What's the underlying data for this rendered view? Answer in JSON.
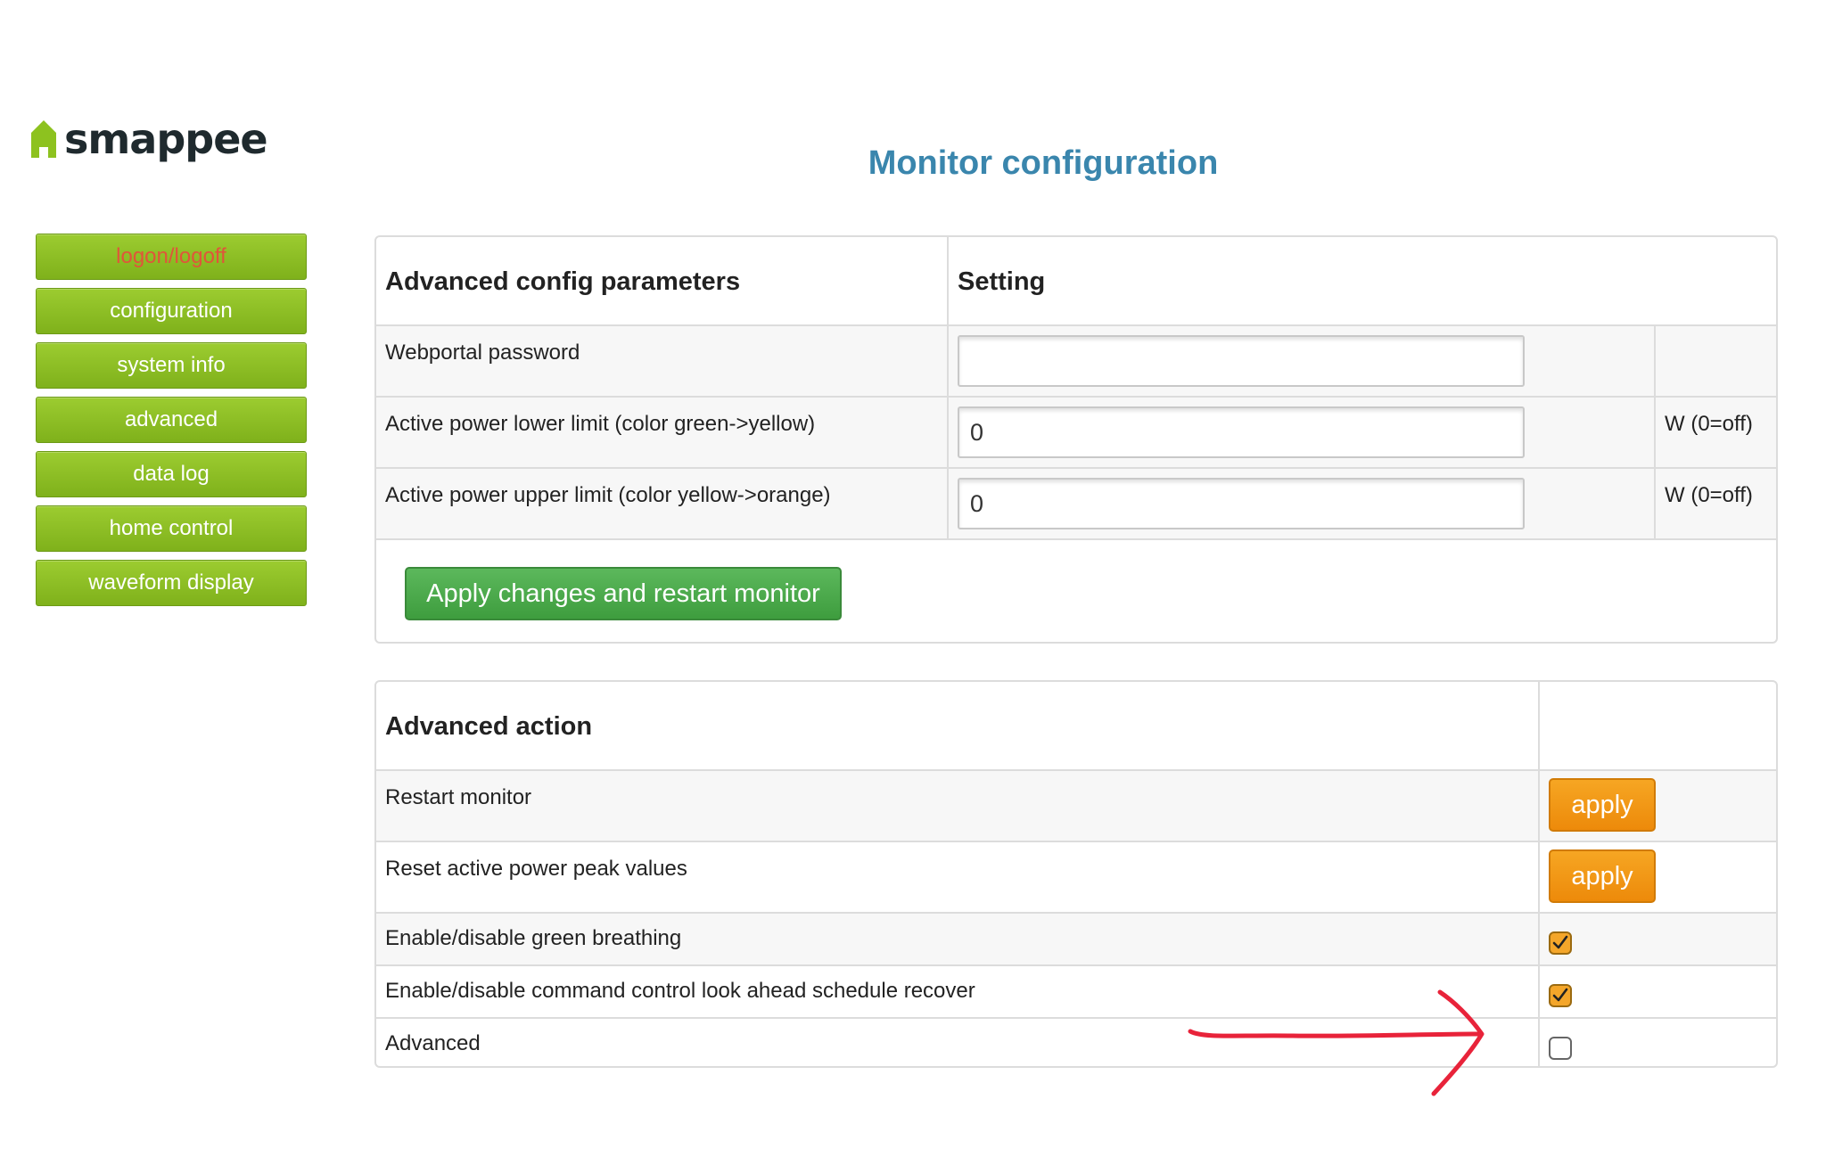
{
  "brand": {
    "name": "smappee",
    "accent": "#8dc21f"
  },
  "page": {
    "title": "Monitor configuration"
  },
  "sidebar": {
    "items": [
      {
        "label": "logon/logoff",
        "active": true
      },
      {
        "label": "configuration"
      },
      {
        "label": "system info"
      },
      {
        "label": "advanced"
      },
      {
        "label": "data log"
      },
      {
        "label": "home control"
      },
      {
        "label": "waveform display"
      }
    ]
  },
  "config_table": {
    "headers": [
      "Advanced config parameters",
      "Setting"
    ],
    "rows": [
      {
        "label": "Webportal password",
        "value": "",
        "unit": ""
      },
      {
        "label": "Active power lower limit (color green->yellow)",
        "value": "0",
        "unit": "W (0=off)"
      },
      {
        "label": "Active power upper limit (color yellow->orange)",
        "value": "0",
        "unit": "W (0=off)"
      }
    ],
    "submit_label": "Apply changes and restart monitor"
  },
  "action_table": {
    "header": "Advanced action",
    "rows": [
      {
        "label": "Restart monitor",
        "control": "button",
        "button_label": "apply"
      },
      {
        "label": "Reset active power peak values",
        "control": "button",
        "button_label": "apply"
      },
      {
        "label": "Enable/disable green breathing",
        "control": "checkbox",
        "checked": true
      },
      {
        "label": "Enable/disable command control look ahead schedule recover",
        "control": "checkbox",
        "checked": true
      },
      {
        "label": "Advanced",
        "control": "checkbox",
        "checked": false
      }
    ]
  },
  "colors": {
    "title": "#3a86ad",
    "nav_button": "#8dc21f",
    "active_nav_text": "#e0553a",
    "primary_button": "#4cae4c",
    "apply_button": "#f0962b",
    "annotation": "#e8233a"
  },
  "icons": {
    "logo": "house-icon",
    "check": "check-icon",
    "annotation": "red-arrow-annotation"
  }
}
